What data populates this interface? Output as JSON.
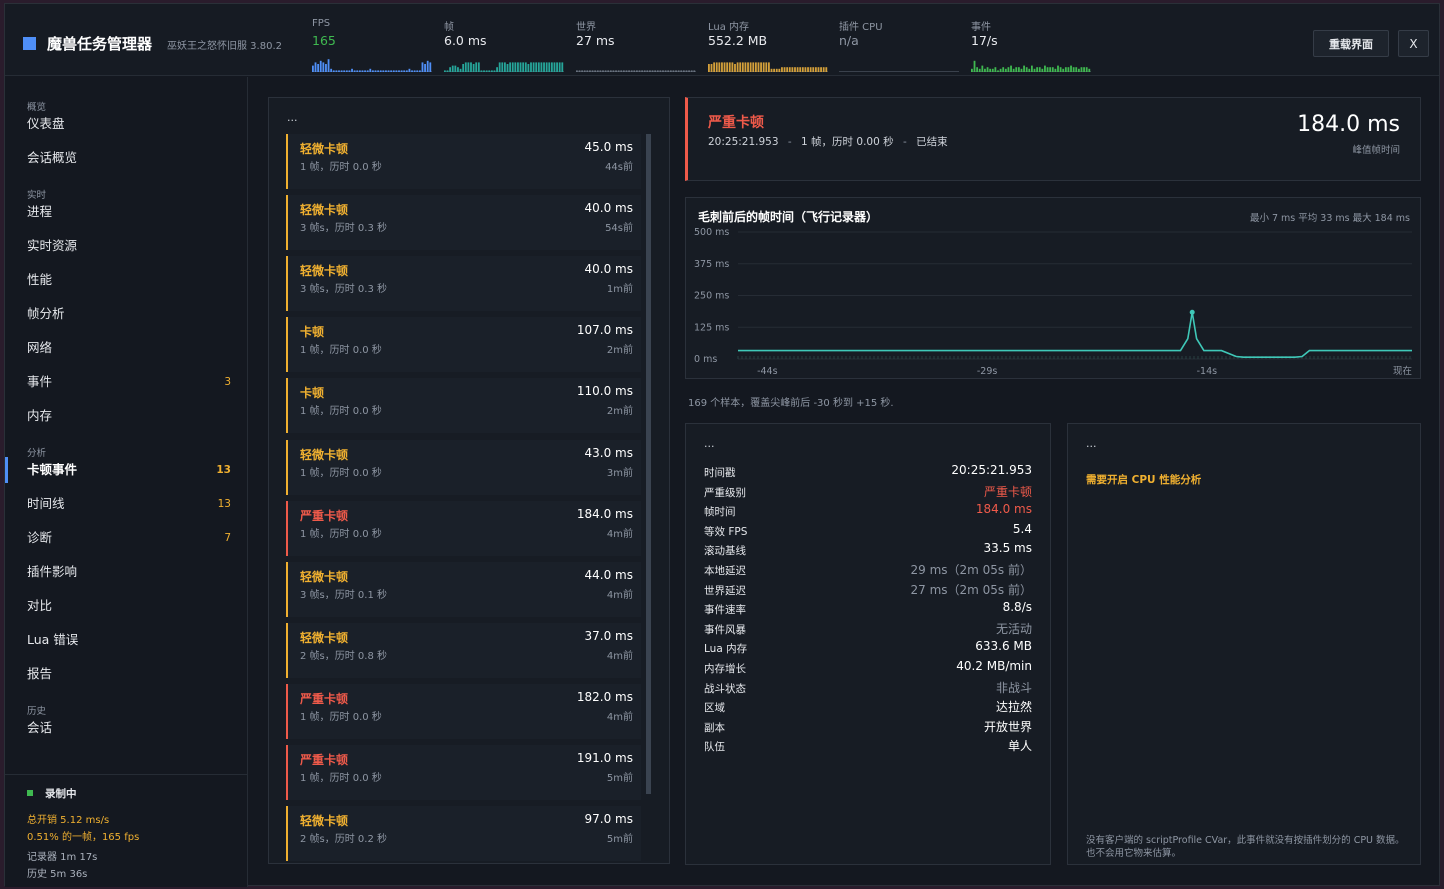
{
  "app": {
    "title": "魔兽任务管理器",
    "subtitle": "巫妖王之怒怀旧服 3.80.2",
    "reload_label": "重载界面",
    "close_label": "X",
    "accent": "#4f8ff7"
  },
  "metrics": [
    {
      "label": "FPS",
      "value": "165",
      "color": "#3fb950",
      "spark_color": "#4f8ff7",
      "bars": [
        4,
        6,
        5,
        7,
        6,
        5,
        8,
        2,
        1,
        1,
        1,
        1,
        1,
        1,
        1,
        2,
        1,
        1,
        1,
        1,
        1,
        1,
        2,
        1,
        1,
        1,
        1,
        1,
        1,
        1,
        1,
        1,
        1,
        1,
        1,
        1,
        1,
        2,
        1,
        1,
        1,
        1,
        6,
        5,
        7,
        6
      ]
    },
    {
      "label": "帧",
      "value": "6.0 ms",
      "color": "#e8eaee",
      "spark_color": "#26a69a",
      "bars": [
        1,
        1,
        3,
        4,
        4,
        3,
        2,
        5,
        6,
        6,
        6,
        5,
        6,
        6,
        1,
        1,
        1,
        1,
        1,
        1,
        3,
        6,
        6,
        6,
        5,
        6,
        6,
        6,
        6,
        6,
        6,
        6,
        5,
        6,
        6,
        6,
        6,
        6,
        6,
        6,
        6,
        6,
        6,
        6,
        6,
        6
      ]
    },
    {
      "label": "世界",
      "value": "27 ms",
      "color": "#e8eaee",
      "spark_color": "#6a7380",
      "bars": [
        1,
        1,
        1,
        1,
        1,
        1,
        1,
        1,
        1,
        1,
        1,
        1,
        1,
        1,
        1,
        1,
        1,
        1,
        1,
        1,
        1,
        1,
        1,
        1,
        1,
        1,
        1,
        1,
        1,
        1,
        1,
        1,
        1,
        1,
        1,
        1,
        1,
        1,
        1,
        1,
        1,
        1,
        1,
        1,
        1,
        1
      ]
    },
    {
      "label": "Lua 内存",
      "value": "552.2 MB",
      "color": "#e8eaee",
      "spark_color": "#d4a03a",
      "bars": [
        5,
        5,
        6,
        6,
        6,
        6,
        6,
        6,
        6,
        6,
        5,
        6,
        6,
        6,
        6,
        6,
        6,
        6,
        6,
        6,
        6,
        6,
        6,
        6,
        2,
        2,
        2,
        2,
        3,
        3,
        3,
        3,
        3,
        3,
        3,
        3,
        3,
        3,
        3,
        3,
        3,
        3,
        3,
        3,
        3,
        3
      ]
    },
    {
      "label": "插件 CPU",
      "value": "n/a",
      "color": "#8e96a3",
      "spark_color": "#6a7380",
      "bars": []
    },
    {
      "label": "事件",
      "value": "17/s",
      "color": "#e8eaee",
      "spark_color": "#3fb950",
      "bars": [
        2,
        7,
        3,
        2,
        4,
        2,
        3,
        2,
        2,
        3,
        1,
        2,
        3,
        2,
        3,
        4,
        2,
        3,
        3,
        2,
        4,
        3,
        2,
        4,
        2,
        3,
        3,
        2,
        4,
        3,
        3,
        3,
        2,
        4,
        3,
        2,
        3,
        3,
        4,
        3,
        3,
        2,
        3,
        3,
        3,
        2
      ]
    }
  ],
  "nav": {
    "sections": [
      {
        "label": "概览",
        "items": [
          {
            "label": "仪表盘"
          },
          {
            "label": "会话概览"
          }
        ]
      },
      {
        "label": "实时",
        "items": [
          {
            "label": "进程"
          },
          {
            "label": "实时资源"
          },
          {
            "label": "性能"
          },
          {
            "label": "帧分析"
          },
          {
            "label": "网络"
          },
          {
            "label": "事件",
            "badge": "3"
          },
          {
            "label": "内存"
          }
        ]
      },
      {
        "label": "分析",
        "items": [
          {
            "label": "卡顿事件",
            "badge": "13",
            "active": true
          },
          {
            "label": "时间线",
            "badge": "13"
          },
          {
            "label": "诊断",
            "badge": "7"
          },
          {
            "label": "插件影响"
          },
          {
            "label": "对比"
          },
          {
            "label": "Lua 错误"
          },
          {
            "label": "报告"
          }
        ]
      },
      {
        "label": "历史",
        "items": [
          {
            "label": "会话"
          }
        ]
      }
    ]
  },
  "recording": {
    "status": "录制中",
    "overhead": "总开销 5.12 ms/s",
    "fraction": "0.51% 的一帧，165 fps",
    "recorder": "记录器 1m 17s",
    "history": "历史 5m 36s"
  },
  "spike_list": {
    "header": "...",
    "items": [
      {
        "title": "轻微卡顿",
        "sub": "1 帧，历时 0.0 秒",
        "ms": "45.0 ms",
        "ago": "44s前",
        "severe": false
      },
      {
        "title": "轻微卡顿",
        "sub": "3 帧s，历时 0.3 秒",
        "ms": "40.0 ms",
        "ago": "54s前",
        "severe": false
      },
      {
        "title": "轻微卡顿",
        "sub": "3 帧s，历时 0.3 秒",
        "ms": "40.0 ms",
        "ago": "1m前",
        "severe": false
      },
      {
        "title": "卡顿",
        "sub": "1 帧，历时 0.0 秒",
        "ms": "107.0 ms",
        "ago": "2m前",
        "severe": false
      },
      {
        "title": "卡顿",
        "sub": "1 帧，历时 0.0 秒",
        "ms": "110.0 ms",
        "ago": "2m前",
        "severe": false
      },
      {
        "title": "轻微卡顿",
        "sub": "1 帧，历时 0.0 秒",
        "ms": "43.0 ms",
        "ago": "3m前",
        "severe": false
      },
      {
        "title": "严重卡顿",
        "sub": "1 帧，历时 0.0 秒",
        "ms": "184.0 ms",
        "ago": "4m前",
        "severe": true
      },
      {
        "title": "轻微卡顿",
        "sub": "3 帧s，历时 0.1 秒",
        "ms": "44.0 ms",
        "ago": "4m前",
        "severe": false
      },
      {
        "title": "轻微卡顿",
        "sub": "2 帧s，历时 0.8 秒",
        "ms": "37.0 ms",
        "ago": "4m前",
        "severe": false
      },
      {
        "title": "严重卡顿",
        "sub": "1 帧，历时 0.0 秒",
        "ms": "182.0 ms",
        "ago": "4m前",
        "severe": true
      },
      {
        "title": "严重卡顿",
        "sub": "1 帧，历时 0.0 秒",
        "ms": "191.0 ms",
        "ago": "5m前",
        "severe": true
      },
      {
        "title": "轻微卡顿",
        "sub": "2 帧s，历时 0.2 秒",
        "ms": "97.0 ms",
        "ago": "5m前",
        "severe": false
      }
    ]
  },
  "detail": {
    "title": "严重卡顿",
    "timestamp": "20:25:21.953",
    "sep1": "-",
    "frames": "1 帧，历时 0.00 秒",
    "sep2": "-",
    "state": "已结束",
    "peak": "184.0 ms",
    "peak_label": "峰值帧时间",
    "danger_color": "#ef5a4a"
  },
  "chart_data": {
    "type": "line",
    "title": "毛刺前后的帧时间（飞行记录器）",
    "stats": "最小 7 ms  平均 33 ms  最大 184 ms",
    "ylim": [
      0,
      500
    ],
    "y_ticks": [
      {
        "v": 500,
        "label": "500 ms"
      },
      {
        "v": 375,
        "label": "375 ms"
      },
      {
        "v": 250,
        "label": "250 ms"
      },
      {
        "v": 125,
        "label": "125 ms"
      },
      {
        "v": 0,
        "label": "0 ms"
      }
    ],
    "xlim": [
      -46,
      0
    ],
    "x_ticks": [
      {
        "v": -44,
        "label": "-44s"
      },
      {
        "v": -29,
        "label": "-29s"
      },
      {
        "v": -14,
        "label": "-14s"
      },
      {
        "v": 0,
        "label": "现在"
      }
    ],
    "x": [
      -46,
      -44,
      -40,
      -36,
      -32,
      -28,
      -24,
      -20,
      -17,
      -15.8,
      -15.3,
      -15,
      -14.7,
      -14.2,
      -13,
      -12,
      -11.5,
      -10,
      -8,
      -7.5,
      -7,
      -4,
      -2,
      0
    ],
    "y": [
      33,
      33,
      33,
      33,
      33,
      33,
      33,
      33,
      33,
      33,
      80,
      184,
      80,
      33,
      33,
      10,
      7,
      7,
      7,
      10,
      33,
      33,
      33,
      33
    ],
    "color": "#3fc8b8",
    "caption": "169 个样本，覆盖尖峰前后 -30 秒到 +15 秒."
  },
  "snapshot": {
    "header": "...",
    "rows": [
      {
        "key": "时间戳",
        "val": "20:25:21.953",
        "color": "#ffffff"
      },
      {
        "key": "严重级别",
        "val": "严重卡顿",
        "color": "#ef5a4a"
      },
      {
        "key": "帧时间",
        "val": "184.0 ms",
        "color": "#ef5a4a"
      },
      {
        "key": "等效 FPS",
        "val": "5.4",
        "color": "#ffffff"
      },
      {
        "key": "滚动基线",
        "val": "33.5 ms",
        "color": "#ffffff"
      },
      {
        "key": "本地延迟",
        "val": "29 ms（2m 05s 前）",
        "color": "#8e96a3"
      },
      {
        "key": "世界延迟",
        "val": "27 ms（2m 05s 前）",
        "color": "#8e96a3"
      },
      {
        "key": "事件速率",
        "val": "8.8/s",
        "color": "#ffffff"
      },
      {
        "key": "事件风暴",
        "val": "无活动",
        "color": "#8e96a3"
      },
      {
        "key": "Lua 内存",
        "val": "633.6 MB",
        "color": "#ffffff"
      },
      {
        "key": "内存增长",
        "val": "40.2 MB/min",
        "color": "#ffffff"
      },
      {
        "key": "战斗状态",
        "val": "非战斗",
        "color": "#8e96a3"
      },
      {
        "key": "区域",
        "val": "达拉然",
        "color": "#ffffff"
      },
      {
        "key": "副本",
        "val": "开放世界",
        "color": "#ffffff"
      },
      {
        "key": "队伍",
        "val": "单人",
        "color": "#ffffff"
      }
    ]
  },
  "cpu": {
    "header": "...",
    "warning": "需要开启 CPU 性能分析",
    "note": "没有客户端的 scriptProfile CVar，此事件就没有按插件划分的 CPU 数据。也不会用它物来估算。"
  }
}
